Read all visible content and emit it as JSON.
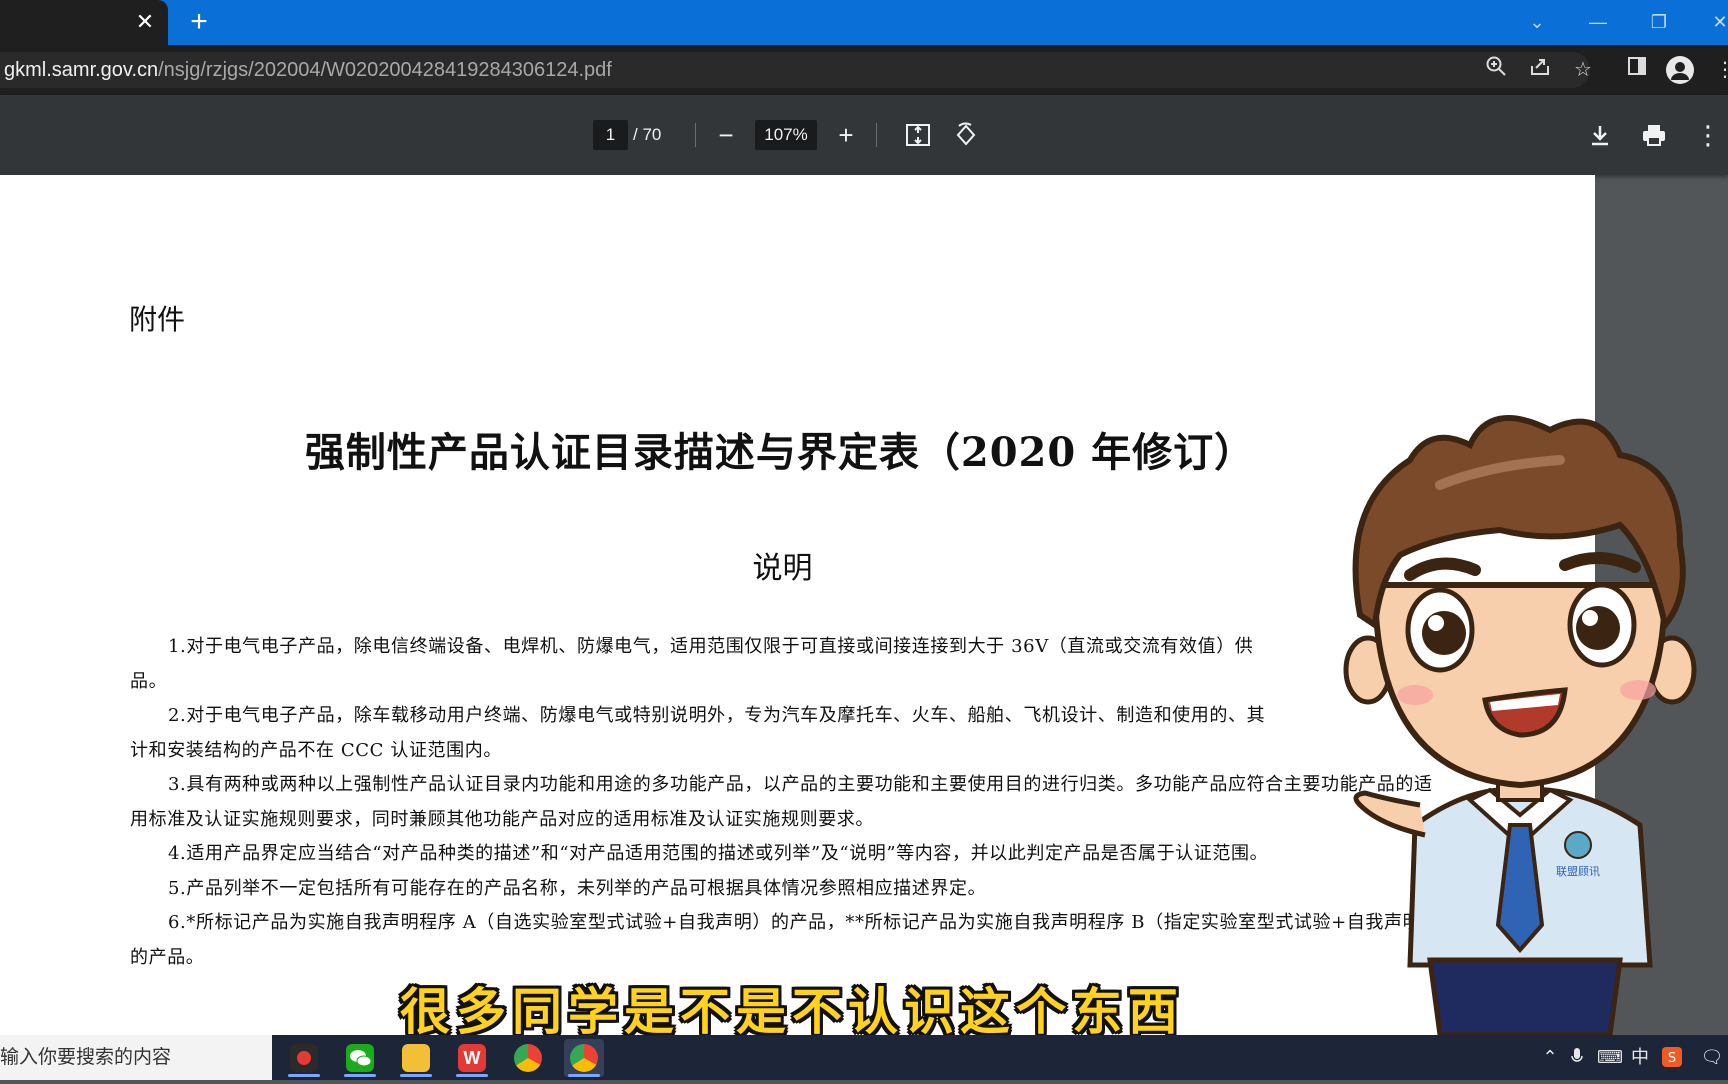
{
  "browser": {
    "tab_close": "✕",
    "new_tab": "+",
    "url_host": "gkml.samr.gov.cn",
    "url_path": "/nsjg/rzjgs/202004/W020200428419284306124.pdf"
  },
  "pdf_toolbar": {
    "page_current": "1",
    "page_total": "/ 70",
    "zoom": "107%"
  },
  "document": {
    "attachment_label": "附件",
    "title": "强制性产品认证目录描述与界定表（2020 年修订）",
    "subtitle": "说明",
    "paragraphs": [
      "1.对于电气电子产品，除电信终端设备、电焊机、防爆电气，适用范围仅限于可直接或间接连接到大于 36V（直流或交流有效值）供",
      "2.对于电气电子产品，除车载移动用户终端、防爆电气或特别说明外，专为汽车及摩托车、火车、船舶、飞机设计、制造和使用的、其",
      "3.具有两种或两种以上强制性产品认证目录内功能和用途的多功能产品，以产品的主要功能和主要使用目的进行归类。多功能产品应符合主要功能产品的适用标准及认证实施规则要求，同时兼顾其他功能产品对应的适用标准及认证实施规则要求。",
      "4.适用产品界定应当结合“对产品种类的描述”和“对产品适用范围的描述或列举”及“说明”等内容，并以此判定产品是否属于认证范围。",
      "5.产品列举不一定包括所有可能存在的产品名称，未列举的产品可根据具体情况参照相应描述界定。",
      "6.*所标记产品为实施自我声明程序 A（自选实验室型式试验+自我声明）的产品，**所标记产品为实施自我声明程序 B（指定实验室型式试验+自我声明）的产品。"
    ],
    "para1_cont": "品。",
    "para2_cont": "计和安装结构的产品不在 CCC 认证范围内。"
  },
  "caption": "很多同学是不是不认识这个东西",
  "taskbar": {
    "search_placeholder": "输入你要搜索的内容",
    "tray_ime": "中"
  },
  "mascot": {
    "badge_text": "联盟顾讯"
  }
}
